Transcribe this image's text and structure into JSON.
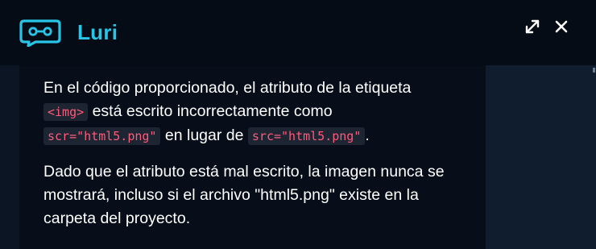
{
  "header": {
    "app_name": "Luri",
    "logo_icon": "chat-bubble-link-icon",
    "expand_icon": "expand-arrows-icon",
    "close_icon": "close-icon",
    "brand_color": "#29c4e6"
  },
  "message": {
    "p1_text1": "En el código proporcionado, el atributo de la etiqueta",
    "p1_code1": "<img>",
    "p1_text2": " está escrito incorrectamente como",
    "p1_code2": "scr=\"html5.png\"",
    "p1_text3": " en lugar de ",
    "p1_code3": "src=\"html5.png\"",
    "p1_text4": ".",
    "p2": "Dado que el atributo está mal escrito, la imagen nunca se mostrará, incluso si el archivo \"html5.png\" existe en la carpeta del proyecto."
  }
}
